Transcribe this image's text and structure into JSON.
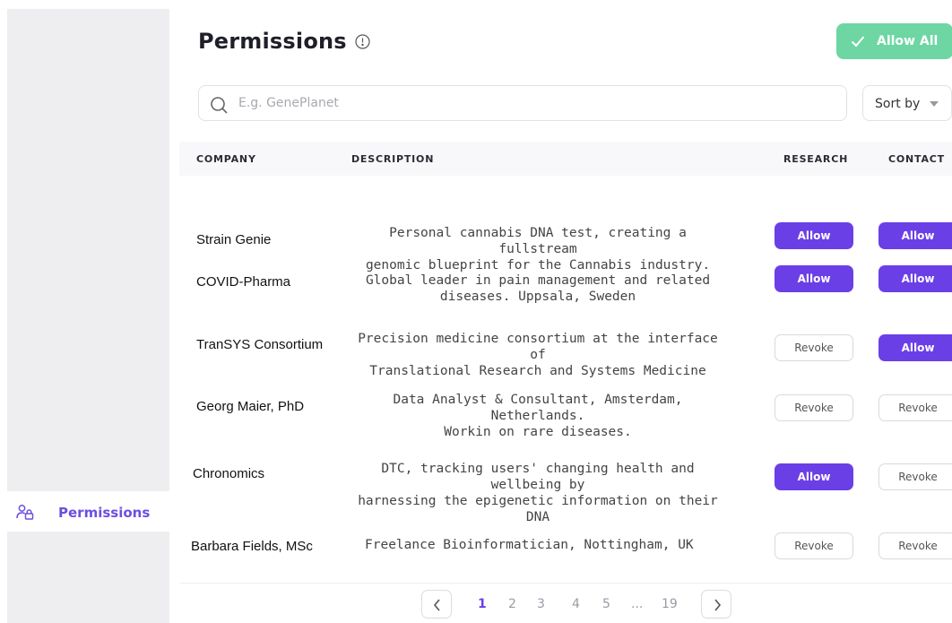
{
  "sidebar": {
    "active_item": {
      "label": "Permissions",
      "icon": "user-lock-icon"
    }
  },
  "header": {
    "title": "Permissions",
    "info_icon": "info-circle-icon",
    "allow_all_label": "Allow All"
  },
  "search": {
    "placeholder": "E.g. GenePlanet",
    "value": ""
  },
  "sort": {
    "label": "Sort by"
  },
  "table": {
    "columns": [
      "COMPANY",
      "DESCRIPTION",
      "RESEARCH",
      "CONTACT"
    ],
    "rows": [
      {
        "company": "Strain Genie",
        "desc1": "Personal cannabis DNA test, creating a fullstream",
        "desc2": "genomic blueprint for the Cannabis industry.",
        "research": "Allow",
        "contact": "Allow"
      },
      {
        "company": "COVID-Pharma",
        "desc1": "Global leader in pain management and related",
        "desc2": "diseases. Uppsala, Sweden",
        "research": "Allow",
        "contact": "Allow"
      },
      {
        "company": "TranSYS Consortium",
        "desc1": "Precision medicine consortium at the interface of",
        "desc2": "Translational Research and Systems Medicine",
        "research": "Revoke",
        "contact": "Allow"
      },
      {
        "company": "Georg Maier, PhD",
        "desc1": "Data Analyst & Consultant, Amsterdam, Netherlands.",
        "desc2": "Workin on rare diseases.",
        "research": "Revoke",
        "contact": "Revoke"
      },
      {
        "company": "Chronomics",
        "desc1": "DTC, tracking users' changing health and wellbeing by",
        "desc2": "harnessing the epigenetic information on their DNA",
        "research": "Allow",
        "contact": "Revoke"
      },
      {
        "company": "Barbara Fields, MSc",
        "desc1": "Freelance Bioinformatician, Nottingham, UK",
        "desc2": "",
        "research": "Revoke",
        "contact": "Revoke"
      }
    ]
  },
  "pagination": {
    "pages": [
      "1",
      "2",
      "3",
      "4",
      "5",
      "...",
      "19"
    ],
    "current": "1"
  },
  "colors": {
    "accent": "#6b3fe6",
    "allow_all": "#6dd6a3",
    "sidebar_bg": "#eeeef0"
  }
}
